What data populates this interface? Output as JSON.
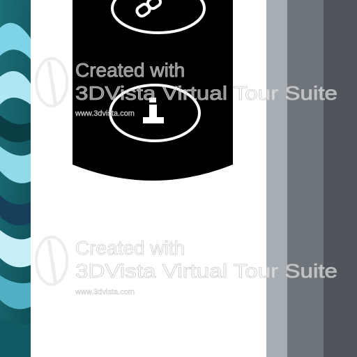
{
  "toolbar": {
    "buttons": [
      {
        "icon": "link-icon",
        "label": ""
      },
      {
        "icon": "info-icon",
        "label": ""
      }
    ]
  },
  "watermark": {
    "line1": "Created with",
    "line2": "3DVista Virtual Tour Suite",
    "url": "www.3dvista.com"
  }
}
